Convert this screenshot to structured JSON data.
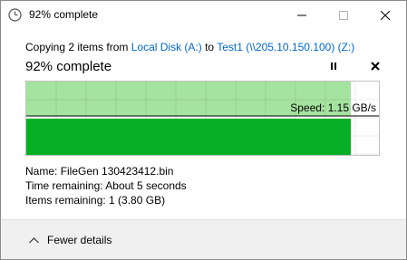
{
  "window": {
    "title": "92% complete"
  },
  "dialog": {
    "copy_prefix": "Copying 2 items from ",
    "source": "Local Disk (A:)",
    "to_word": " to ",
    "destination": "Test1 (\\\\205.10.150.100) (Z:)",
    "percent_heading": "92% complete",
    "progress_fraction": 0.92,
    "speed_label": "Speed: 1.15 GB/s",
    "accent_green": "#06b025",
    "graph_fill": "#a5e3a0"
  },
  "details": {
    "name_label": "Name:",
    "name_value": "FileGen 130423412.bin",
    "time_label": "Time remaining:",
    "time_value": "About 5 seconds",
    "items_label": "Items remaining:",
    "items_value": "1 (3.80 GB)"
  },
  "footer": {
    "fewer_details": "Fewer details"
  },
  "icons": {
    "app": "clock-icon",
    "minimize": "minimize-icon",
    "maximize": "maximize-icon",
    "close": "close-icon",
    "pause": "pause-icon",
    "cancel": "cancel-icon",
    "collapse": "chevron-up-icon"
  }
}
